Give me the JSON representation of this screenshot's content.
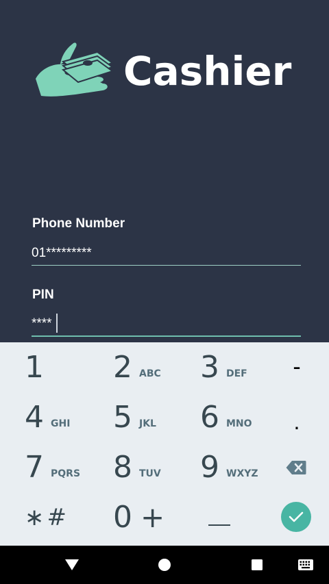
{
  "app": {
    "brand": "Cashier",
    "brand_color": "#ffffff",
    "accent": "#6fbfae",
    "background": "#2c3446"
  },
  "form": {
    "phone_label": "Phone Number",
    "phone_value": "01*********",
    "pin_label": "PIN",
    "pin_value": "****"
  },
  "keypad": {
    "keys": [
      {
        "digit": "1",
        "letters": ""
      },
      {
        "digit": "2",
        "letters": "ABC"
      },
      {
        "digit": "3",
        "letters": "DEF"
      },
      {
        "digit": "4",
        "letters": "GHI"
      },
      {
        "digit": "5",
        "letters": "JKL"
      },
      {
        "digit": "6",
        "letters": "MNO"
      },
      {
        "digit": "7",
        "letters": "PQRS"
      },
      {
        "digit": "8",
        "letters": "TUV"
      },
      {
        "digit": "9",
        "letters": "WXYZ"
      },
      {
        "digit": "0",
        "letters": ""
      }
    ],
    "minus": "-",
    "dot": ".",
    "star_hash": "∗#",
    "plus": "+",
    "space": "⎵",
    "icons": {
      "backspace": "backspace-icon",
      "done": "check-icon"
    },
    "done_color": "#48b5a3"
  },
  "navbar": {
    "icons": [
      "back-triangle-icon",
      "home-circle-icon",
      "recents-square-icon",
      "keyboard-icon"
    ]
  }
}
